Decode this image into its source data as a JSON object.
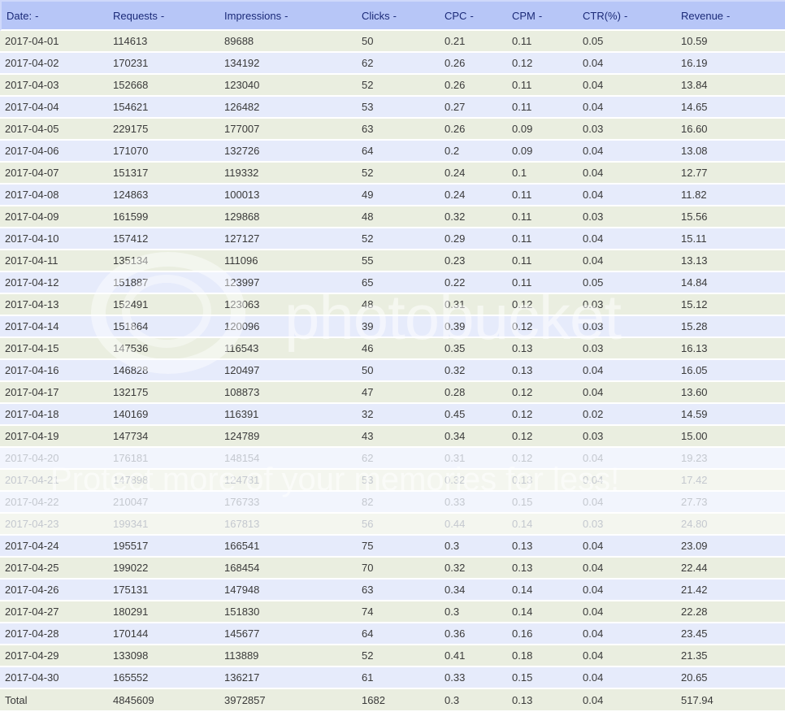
{
  "table": {
    "columns": [
      {
        "label": "Date:",
        "arrow": "-"
      },
      {
        "label": "Requests",
        "arrow": "-"
      },
      {
        "label": "Impressions",
        "arrow": "-"
      },
      {
        "label": "Clicks",
        "arrow": "-"
      },
      {
        "label": "CPC",
        "arrow": "-"
      },
      {
        "label": "CPM",
        "arrow": "-"
      },
      {
        "label": "CTR(%)",
        "arrow": "-"
      },
      {
        "label": "Revenue",
        "arrow": "-"
      }
    ],
    "rows": [
      [
        "2017-04-01",
        "114613",
        "89688",
        "50",
        "0.21",
        "0.11",
        "0.05",
        "10.59"
      ],
      [
        "2017-04-02",
        "170231",
        "134192",
        "62",
        "0.26",
        "0.12",
        "0.04",
        "16.19"
      ],
      [
        "2017-04-03",
        "152668",
        "123040",
        "52",
        "0.26",
        "0.11",
        "0.04",
        "13.84"
      ],
      [
        "2017-04-04",
        "154621",
        "126482",
        "53",
        "0.27",
        "0.11",
        "0.04",
        "14.65"
      ],
      [
        "2017-04-05",
        "229175",
        "177007",
        "63",
        "0.26",
        "0.09",
        "0.03",
        "16.60"
      ],
      [
        "2017-04-06",
        "171070",
        "132726",
        "64",
        "0.2",
        "0.09",
        "0.04",
        "13.08"
      ],
      [
        "2017-04-07",
        "151317",
        "119332",
        "52",
        "0.24",
        "0.1",
        "0.04",
        "12.77"
      ],
      [
        "2017-04-08",
        "124863",
        "100013",
        "49",
        "0.24",
        "0.11",
        "0.04",
        "11.82"
      ],
      [
        "2017-04-09",
        "161599",
        "129868",
        "48",
        "0.32",
        "0.11",
        "0.03",
        "15.56"
      ],
      [
        "2017-04-10",
        "157412",
        "127127",
        "52",
        "0.29",
        "0.11",
        "0.04",
        "15.11"
      ],
      [
        "2017-04-11",
        "135134",
        "111096",
        "55",
        "0.23",
        "0.11",
        "0.04",
        "13.13"
      ],
      [
        "2017-04-12",
        "151887",
        "123997",
        "65",
        "0.22",
        "0.11",
        "0.05",
        "14.84"
      ],
      [
        "2017-04-13",
        "152491",
        "123063",
        "48",
        "0.31",
        "0.12",
        "0.03",
        "15.12"
      ],
      [
        "2017-04-14",
        "151864",
        "120096",
        "39",
        "0.39",
        "0.12",
        "0.03",
        "15.28"
      ],
      [
        "2017-04-15",
        "147536",
        "116543",
        "46",
        "0.35",
        "0.13",
        "0.03",
        "16.13"
      ],
      [
        "2017-04-16",
        "146828",
        "120497",
        "50",
        "0.32",
        "0.13",
        "0.04",
        "16.05"
      ],
      [
        "2017-04-17",
        "132175",
        "108873",
        "47",
        "0.28",
        "0.12",
        "0.04",
        "13.60"
      ],
      [
        "2017-04-18",
        "140169",
        "116391",
        "32",
        "0.45",
        "0.12",
        "0.02",
        "14.59"
      ],
      [
        "2017-04-19",
        "147734",
        "124789",
        "43",
        "0.34",
        "0.12",
        "0.03",
        "15.00"
      ],
      [
        "2017-04-20",
        "176181",
        "148154",
        "62",
        "0.31",
        "0.12",
        "0.04",
        "19.23"
      ],
      [
        "2017-04-21",
        "147898",
        "124781",
        "53",
        "0.32",
        "0.13",
        "0.04",
        "17.42"
      ],
      [
        "2017-04-22",
        "210047",
        "176733",
        "82",
        "0.33",
        "0.15",
        "0.04",
        "27.73"
      ],
      [
        "2017-04-23",
        "199341",
        "167813",
        "56",
        "0.44",
        "0.14",
        "0.03",
        "24.80"
      ],
      [
        "2017-04-24",
        "195517",
        "166541",
        "75",
        "0.3",
        "0.13",
        "0.04",
        "23.09"
      ],
      [
        "2017-04-25",
        "199022",
        "168454",
        "70",
        "0.32",
        "0.13",
        "0.04",
        "22.44"
      ],
      [
        "2017-04-26",
        "175131",
        "147948",
        "63",
        "0.34",
        "0.14",
        "0.04",
        "21.42"
      ],
      [
        "2017-04-27",
        "180291",
        "151830",
        "74",
        "0.3",
        "0.14",
        "0.04",
        "22.28"
      ],
      [
        "2017-04-28",
        "170144",
        "145677",
        "64",
        "0.36",
        "0.16",
        "0.04",
        "23.45"
      ],
      [
        "2017-04-29",
        "133098",
        "113889",
        "52",
        "0.41",
        "0.18",
        "0.04",
        "21.35"
      ],
      [
        "2017-04-30",
        "165552",
        "136217",
        "61",
        "0.33",
        "0.15",
        "0.04",
        "20.65"
      ]
    ],
    "faded_rows": [
      19,
      20,
      21,
      22
    ],
    "total": [
      "Total",
      "4845609",
      "3972857",
      "1682",
      "0.3",
      "0.13",
      "0.04",
      "517.94"
    ]
  },
  "watermark": {
    "brand": "photobucket",
    "tagline": "Protect more of your memories for less!"
  },
  "colors": {
    "header_bg": "#b7c6f7",
    "header_text": "#1b2a78",
    "row_odd": "#eaeee0",
    "row_even": "#e6ebfb"
  }
}
